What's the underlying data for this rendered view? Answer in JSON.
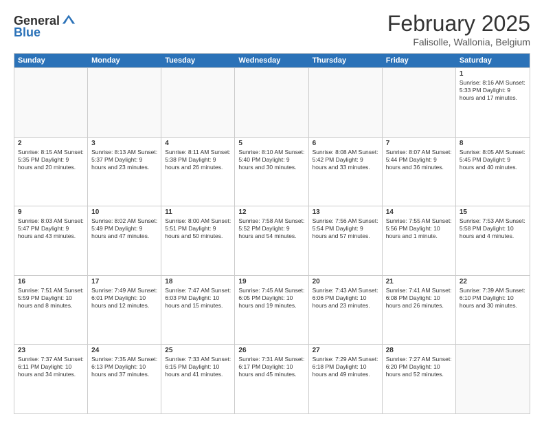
{
  "header": {
    "logo_general": "General",
    "logo_blue": "Blue",
    "month_year": "February 2025",
    "location": "Falisolle, Wallonia, Belgium"
  },
  "calendar": {
    "days_of_week": [
      "Sunday",
      "Monday",
      "Tuesday",
      "Wednesday",
      "Thursday",
      "Friday",
      "Saturday"
    ],
    "rows": [
      [
        {
          "day": "",
          "info": "",
          "empty": true
        },
        {
          "day": "",
          "info": "",
          "empty": true
        },
        {
          "day": "",
          "info": "",
          "empty": true
        },
        {
          "day": "",
          "info": "",
          "empty": true
        },
        {
          "day": "",
          "info": "",
          "empty": true
        },
        {
          "day": "",
          "info": "",
          "empty": true
        },
        {
          "day": "1",
          "info": "Sunrise: 8:16 AM\nSunset: 5:33 PM\nDaylight: 9 hours and 17 minutes."
        }
      ],
      [
        {
          "day": "2",
          "info": "Sunrise: 8:15 AM\nSunset: 5:35 PM\nDaylight: 9 hours and 20 minutes."
        },
        {
          "day": "3",
          "info": "Sunrise: 8:13 AM\nSunset: 5:37 PM\nDaylight: 9 hours and 23 minutes."
        },
        {
          "day": "4",
          "info": "Sunrise: 8:11 AM\nSunset: 5:38 PM\nDaylight: 9 hours and 26 minutes."
        },
        {
          "day": "5",
          "info": "Sunrise: 8:10 AM\nSunset: 5:40 PM\nDaylight: 9 hours and 30 minutes."
        },
        {
          "day": "6",
          "info": "Sunrise: 8:08 AM\nSunset: 5:42 PM\nDaylight: 9 hours and 33 minutes."
        },
        {
          "day": "7",
          "info": "Sunrise: 8:07 AM\nSunset: 5:44 PM\nDaylight: 9 hours and 36 minutes."
        },
        {
          "day": "8",
          "info": "Sunrise: 8:05 AM\nSunset: 5:45 PM\nDaylight: 9 hours and 40 minutes."
        }
      ],
      [
        {
          "day": "9",
          "info": "Sunrise: 8:03 AM\nSunset: 5:47 PM\nDaylight: 9 hours and 43 minutes."
        },
        {
          "day": "10",
          "info": "Sunrise: 8:02 AM\nSunset: 5:49 PM\nDaylight: 9 hours and 47 minutes."
        },
        {
          "day": "11",
          "info": "Sunrise: 8:00 AM\nSunset: 5:51 PM\nDaylight: 9 hours and 50 minutes."
        },
        {
          "day": "12",
          "info": "Sunrise: 7:58 AM\nSunset: 5:52 PM\nDaylight: 9 hours and 54 minutes."
        },
        {
          "day": "13",
          "info": "Sunrise: 7:56 AM\nSunset: 5:54 PM\nDaylight: 9 hours and 57 minutes."
        },
        {
          "day": "14",
          "info": "Sunrise: 7:55 AM\nSunset: 5:56 PM\nDaylight: 10 hours and 1 minute."
        },
        {
          "day": "15",
          "info": "Sunrise: 7:53 AM\nSunset: 5:58 PM\nDaylight: 10 hours and 4 minutes."
        }
      ],
      [
        {
          "day": "16",
          "info": "Sunrise: 7:51 AM\nSunset: 5:59 PM\nDaylight: 10 hours and 8 minutes."
        },
        {
          "day": "17",
          "info": "Sunrise: 7:49 AM\nSunset: 6:01 PM\nDaylight: 10 hours and 12 minutes."
        },
        {
          "day": "18",
          "info": "Sunrise: 7:47 AM\nSunset: 6:03 PM\nDaylight: 10 hours and 15 minutes."
        },
        {
          "day": "19",
          "info": "Sunrise: 7:45 AM\nSunset: 6:05 PM\nDaylight: 10 hours and 19 minutes."
        },
        {
          "day": "20",
          "info": "Sunrise: 7:43 AM\nSunset: 6:06 PM\nDaylight: 10 hours and 23 minutes."
        },
        {
          "day": "21",
          "info": "Sunrise: 7:41 AM\nSunset: 6:08 PM\nDaylight: 10 hours and 26 minutes."
        },
        {
          "day": "22",
          "info": "Sunrise: 7:39 AM\nSunset: 6:10 PM\nDaylight: 10 hours and 30 minutes."
        }
      ],
      [
        {
          "day": "23",
          "info": "Sunrise: 7:37 AM\nSunset: 6:11 PM\nDaylight: 10 hours and 34 minutes."
        },
        {
          "day": "24",
          "info": "Sunrise: 7:35 AM\nSunset: 6:13 PM\nDaylight: 10 hours and 37 minutes."
        },
        {
          "day": "25",
          "info": "Sunrise: 7:33 AM\nSunset: 6:15 PM\nDaylight: 10 hours and 41 minutes."
        },
        {
          "day": "26",
          "info": "Sunrise: 7:31 AM\nSunset: 6:17 PM\nDaylight: 10 hours and 45 minutes."
        },
        {
          "day": "27",
          "info": "Sunrise: 7:29 AM\nSunset: 6:18 PM\nDaylight: 10 hours and 49 minutes."
        },
        {
          "day": "28",
          "info": "Sunrise: 7:27 AM\nSunset: 6:20 PM\nDaylight: 10 hours and 52 minutes."
        },
        {
          "day": "",
          "info": "",
          "empty": true
        }
      ]
    ]
  }
}
